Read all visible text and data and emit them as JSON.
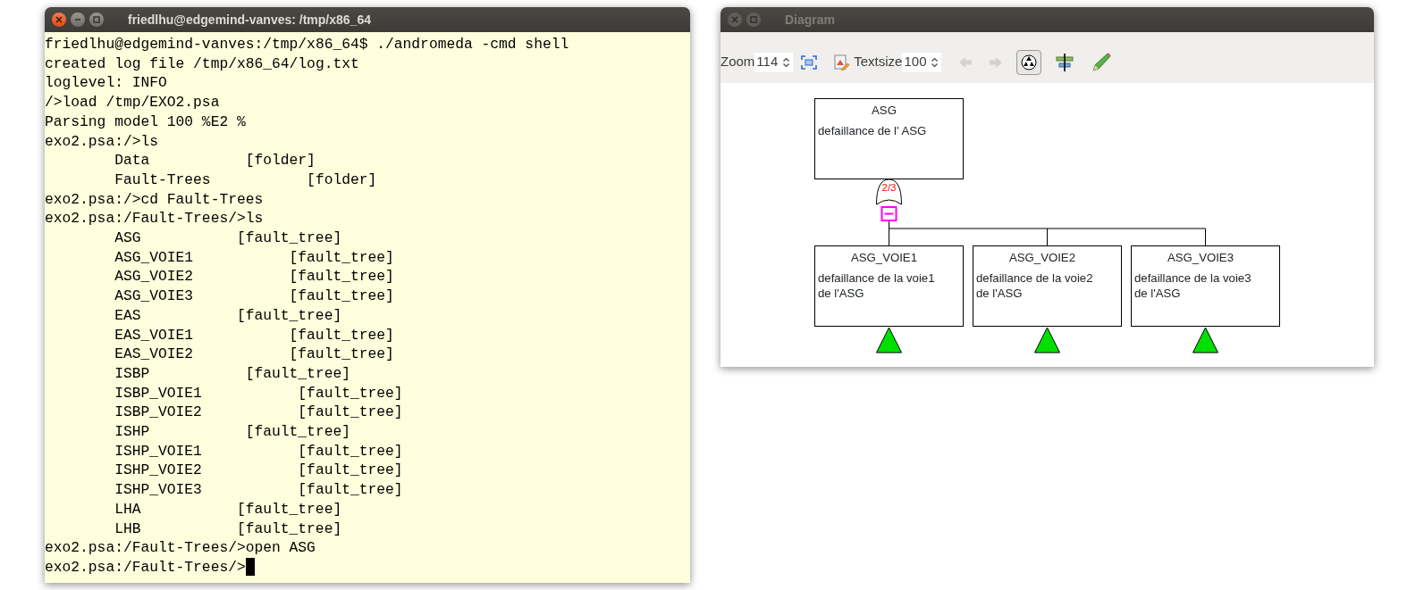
{
  "terminal": {
    "title": "friedlhu@edgemind-vanves: /tmp/x86_64",
    "lines": [
      {
        "kind": "text",
        "text": "friedlhu@edgemind-vanves:/tmp/x86_64$ ./andromeda -cmd shell"
      },
      {
        "kind": "text",
        "text": "created log file /tmp/x86_64/log.txt"
      },
      {
        "kind": "text",
        "text": "loglevel: INFO"
      },
      {
        "kind": "text",
        "text": "/>load /tmp/EXO2.psa"
      },
      {
        "kind": "text",
        "text": "Parsing model 100 %E2 %"
      },
      {
        "kind": "text",
        "text": "exo2.psa:/>ls"
      },
      {
        "kind": "entry",
        "name": "Data",
        "type": "[folder]"
      },
      {
        "kind": "entry",
        "name": "Fault-Trees",
        "type": "[folder]"
      },
      {
        "kind": "text",
        "text": "exo2.psa:/>cd Fault-Trees"
      },
      {
        "kind": "text",
        "text": "exo2.psa:/Fault-Trees/>ls"
      },
      {
        "kind": "entry",
        "name": "ASG",
        "type": "[fault_tree]"
      },
      {
        "kind": "entry",
        "name": "ASG_VOIE1",
        "type": "[fault_tree]"
      },
      {
        "kind": "entry",
        "name": "ASG_VOIE2",
        "type": "[fault_tree]"
      },
      {
        "kind": "entry",
        "name": "ASG_VOIE3",
        "type": "[fault_tree]"
      },
      {
        "kind": "entry",
        "name": "EAS",
        "type": "[fault_tree]"
      },
      {
        "kind": "entry",
        "name": "EAS_VOIE1",
        "type": "[fault_tree]"
      },
      {
        "kind": "entry",
        "name": "EAS_VOIE2",
        "type": "[fault_tree]"
      },
      {
        "kind": "entry",
        "name": "ISBP",
        "type": "[fault_tree]"
      },
      {
        "kind": "entry",
        "name": "ISBP_VOIE1",
        "type": "[fault_tree]"
      },
      {
        "kind": "entry",
        "name": "ISBP_VOIE2",
        "type": "[fault_tree]"
      },
      {
        "kind": "entry",
        "name": "ISHP",
        "type": "[fault_tree]"
      },
      {
        "kind": "entry",
        "name": "ISHP_VOIE1",
        "type": "[fault_tree]"
      },
      {
        "kind": "entry",
        "name": "ISHP_VOIE2",
        "type": "[fault_tree]"
      },
      {
        "kind": "entry",
        "name": "ISHP_VOIE3",
        "type": "[fault_tree]"
      },
      {
        "kind": "entry",
        "name": "LHA",
        "type": "[fault_tree]"
      },
      {
        "kind": "entry",
        "name": "LHB",
        "type": "[fault_tree]"
      },
      {
        "kind": "text",
        "text": "exo2.psa:/Fault-Trees/>open ASG"
      },
      {
        "kind": "prompt",
        "text": "exo2.psa:/Fault-Trees/>"
      }
    ]
  },
  "diagram": {
    "title": "Diagram",
    "toolbar": {
      "zoom": {
        "label": "Zoom",
        "value": "114"
      },
      "textsize": {
        "label": "Textsize",
        "value": "100"
      },
      "back": {
        "disabled": true
      },
      "forward": {
        "disabled": true
      },
      "layout_toggle": {
        "on": true
      }
    },
    "tree": {
      "title": "ASG",
      "description": "defaillance de l' ASG",
      "gate": {
        "label": "2/3"
      },
      "children": [
        {
          "title": "ASG_VOIE1",
          "description": "defaillance de la voie1 de l'ASG",
          "kind": "transfer"
        },
        {
          "title": "ASG_VOIE2",
          "description": "defaillance de la voie2 de l'ASG",
          "kind": "transfer"
        },
        {
          "title": "ASG_VOIE3",
          "description": "defaillance de la voie3 de l'ASG",
          "kind": "transfer"
        }
      ]
    }
  }
}
